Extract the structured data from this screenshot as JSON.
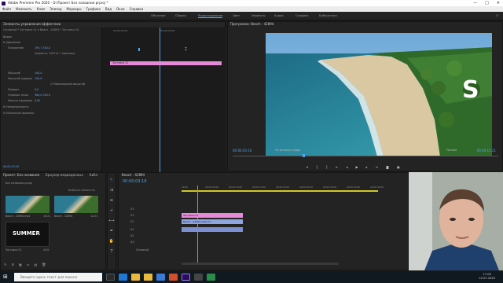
{
  "window": {
    "title": "Adobe Premiere Pro 2020 - D:\\Проект Без названия.prproj *",
    "controls": [
      "—",
      "□",
      "✕"
    ]
  },
  "menu": [
    "Файл",
    "Изменить",
    "Клип",
    "Эпизод",
    "Маркеры",
    "Графика",
    "Вид",
    "Окно",
    "Справка"
  ],
  "workspaces": [
    "Обучение",
    "Сборка",
    "Редактирование",
    "Цвет",
    "Эффекты",
    "Аудио",
    "Графика",
    "Библиотеки"
  ],
  "active_workspace": "Редактирование",
  "effect_controls": {
    "title": "Элементы управления эффектами",
    "source": "Основной * Заставка 01 ▾   Beach - 42894 * Заставка 01",
    "rows": [
      {
        "label": "Видео",
        "value": ""
      },
      {
        "label": "fx  Движение",
        "value": ""
      },
      {
        "label": "Положение",
        "value": "195,7   540,0"
      },
      {
        "label": "",
        "value": "Скорость: 1057,6 ↑ пиксель/с"
      },
      {
        "label": "Масштаб",
        "value": "100,0"
      },
      {
        "label": "Масштаб ширины",
        "value": "100,0"
      },
      {
        "label": "",
        "value": "☑ Равномерный масштаб"
      },
      {
        "label": "Поворот",
        "value": "0,0"
      },
      {
        "label": "Опорная точка",
        "value": "960,0   540,0"
      },
      {
        "label": "Фильтр мерцания",
        "value": "0,00"
      },
      {
        "label": "fx  Непрозрачность",
        "value": ""
      },
      {
        "label": "fx  Изменение времени",
        "value": ""
      }
    ],
    "ruler": [
      "00:00:03:00",
      "00:00:04:00"
    ],
    "clip_label": "Заставка 01",
    "bottom_timecode": "00:00:03:16"
  },
  "program": {
    "title": "Программа: Beach - 42894",
    "overlay_text": "S",
    "timecode_left": "00:00:03:16",
    "fit": "По размеру кадра",
    "quality": "Полное",
    "timecode_right": "00:00:12:21"
  },
  "project": {
    "tabs": [
      "Проект: Без названия",
      "Браузер медиаданных",
      "Библ"
    ],
    "file": "Без названия.prproj",
    "find_placeholder": "Выбрано элементов",
    "items": [
      {
        "name": "Beach - 42894.mp4",
        "dur": "10:21"
      },
      {
        "name": "Beach - 42894",
        "dur": "12:21"
      },
      {
        "name": "Заставка 01",
        "dur": "4:29"
      }
    ],
    "summer_text": "SUMMER"
  },
  "sequence": {
    "title": "Beach - 42894",
    "timecode": "00:00:03:16",
    "ruler": [
      "00:00",
      "00:00:05:00",
      "00:00:10:00",
      "00:00:15:00",
      "00:00:20:00",
      "00:00:25:00",
      "00:00:30:00",
      "00:00:35:00",
      "00:00:40:00",
      "00:00:45:00"
    ],
    "tracks": [
      "V3",
      "V2",
      "V1",
      "A1",
      "A2",
      "A3"
    ],
    "clips": [
      {
        "label": "Заставка 01",
        "color": "#e48ad8"
      },
      {
        "label": "Beach - 42894.mp4 [V]",
        "color": "#8fa5e0"
      },
      {
        "label": "",
        "color": "#7c8fd0"
      }
    ],
    "master": "Основной"
  },
  "taskbar": {
    "search_placeholder": "Введите здесь текст для поиска",
    "time": "17:02",
    "date": "22.07.2020"
  },
  "colors": {
    "accent": "#4fa3f2",
    "clip_pink": "#e48ad8",
    "clip_blue": "#8fa5e0"
  }
}
